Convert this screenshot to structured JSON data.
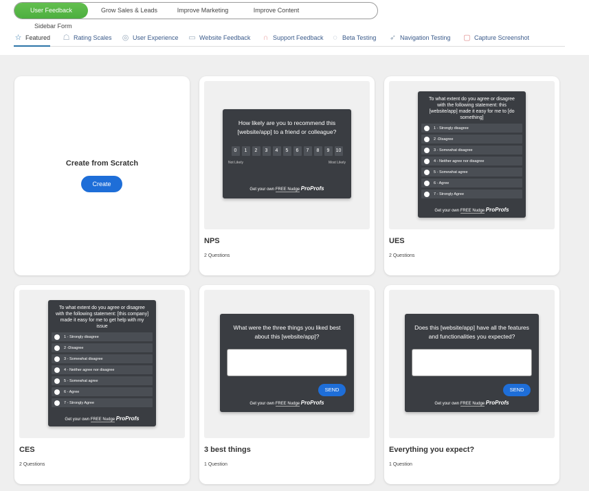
{
  "categories": [
    {
      "label": "User Feedback",
      "active": true
    },
    {
      "label": "Grow Sales & Leads",
      "active": false
    },
    {
      "label": "Improve Marketing",
      "active": false
    },
    {
      "label": "Improve Content",
      "active": false
    }
  ],
  "sidebar_form_label": "Sidebar Form",
  "subtabs": [
    {
      "label": "Featured",
      "icon": "star-icon",
      "active": true
    },
    {
      "label": "Rating Scales",
      "icon": "rating-icon",
      "active": false
    },
    {
      "label": "User Experience",
      "icon": "user-experience-icon",
      "active": false
    },
    {
      "label": "Website Feedback",
      "icon": "website-icon",
      "active": false
    },
    {
      "label": "Support Feedback",
      "icon": "headset-icon",
      "active": false
    },
    {
      "label": "Beta Testing",
      "icon": "beta-icon",
      "active": false
    },
    {
      "label": "Navigation Testing",
      "icon": "navigation-icon",
      "active": false
    },
    {
      "label": "Capture Screenshot",
      "icon": "screenshot-icon",
      "active": false
    }
  ],
  "scratch": {
    "title": "Create from Scratch",
    "button": "Create"
  },
  "footer": {
    "prefix": "Get your own",
    "free": "FREE Nudge",
    "brand": "ProProfs"
  },
  "cards": {
    "nps": {
      "title": "NPS",
      "count": "2 Questions",
      "question": "How likely are you to recommend this [website/app] to a friend or colleague?",
      "scale": [
        "0",
        "1",
        "2",
        "3",
        "4",
        "5",
        "6",
        "7",
        "8",
        "9",
        "10"
      ],
      "low": "Not Likely",
      "high": "Most Likely"
    },
    "ues": {
      "title": "UES",
      "count": "2 Questions",
      "question": "To what extent do you agree or disagree with the following statement: this [website/app] made it easy for me to [do something]",
      "options": [
        "1 - Strongly disagree",
        "2 -Disagree",
        "3 - Somewhat disagree",
        "4 - Neither agree nor disagree",
        "5 - Somewhat agree",
        "6 - Agree",
        "7 - Strongly Agree"
      ]
    },
    "ces": {
      "title": "CES",
      "count": "2 Questions",
      "question": "To what extent do you agree or disagree with the following statement: [this company] made it easy for me to get help with my issue",
      "options": [
        "1 - Strongly disagree",
        "2 -Disagree",
        "3 - Somewhat disagree",
        "4 - Neither agree nor disagree",
        "5 - Somewhat agree",
        "6 - Agree",
        "7 - Strongly Agree"
      ]
    },
    "best": {
      "title": "3 best things",
      "count": "1 Question",
      "question": "What were the three things you liked best about this [website/app]?",
      "send": "SEND"
    },
    "expect": {
      "title": "Everything you expect?",
      "count": "1 Question",
      "question": "Does this [website/app] have all the features and functionalities you expected?",
      "send": "SEND"
    }
  }
}
